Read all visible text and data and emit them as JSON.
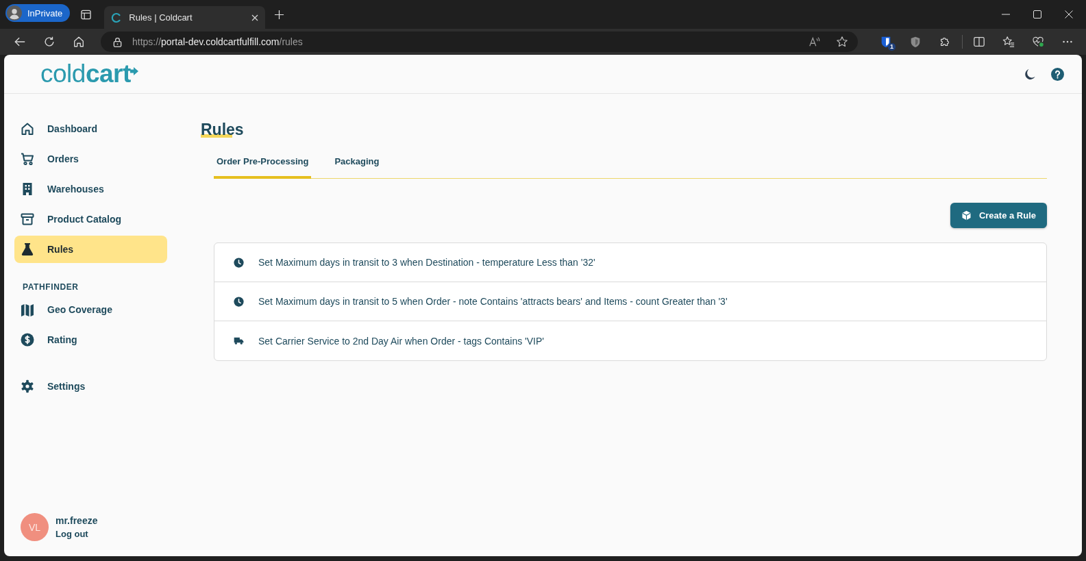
{
  "browser": {
    "profile": "InPrivate",
    "tabs": [
      {
        "title": "Rules | Coldcart",
        "selected": true
      }
    ],
    "address": {
      "scheme": "https://",
      "host": "portal-dev.coldcartfulfill.com",
      "path": "/rules"
    },
    "extension_badge": "1"
  },
  "header": {
    "logo": "cold**cart**"
  },
  "sidebar": {
    "sections": [
      {
        "items": [
          {
            "label": "Dashboard",
            "selected": false
          },
          {
            "label": "Orders",
            "selected": false
          },
          {
            "label": "Warehouses",
            "selected": false
          },
          {
            "label": "Product Catalog",
            "selected": false
          },
          {
            "label": "Rules",
            "selected": true
          }
        ]
      },
      {
        "heading": "PATHFINDER",
        "items": [
          {
            "label": "Geo Coverage",
            "selected": false
          },
          {
            "label": "Rating",
            "selected": false
          }
        ]
      },
      {
        "items": [
          {
            "label": "Settings",
            "selected": false
          }
        ]
      }
    ]
  },
  "user": {
    "initials": "VL",
    "name": "mr.freeze",
    "logout": "Log out"
  },
  "content": {
    "title": "Rules",
    "tabs": [
      {
        "label": "Order Pre-Processing",
        "selected": true
      },
      {
        "label": "Packaging",
        "selected": false
      }
    ],
    "create_button": "Create a Rule",
    "rules": [
      {
        "kind": "transit",
        "text": "Set Maximum days in transit to 3 when Destination - temperature Less than '32'"
      },
      {
        "kind": "transit",
        "text": "Set Maximum days in transit to 5 when Order - note Contains 'attracts bears' and Items - count Greater than '3'"
      },
      {
        "kind": "carrier",
        "text": "Set Carrier Service to 2nd Day Air when Order - tags Contains 'VIP'"
      }
    ]
  }
}
